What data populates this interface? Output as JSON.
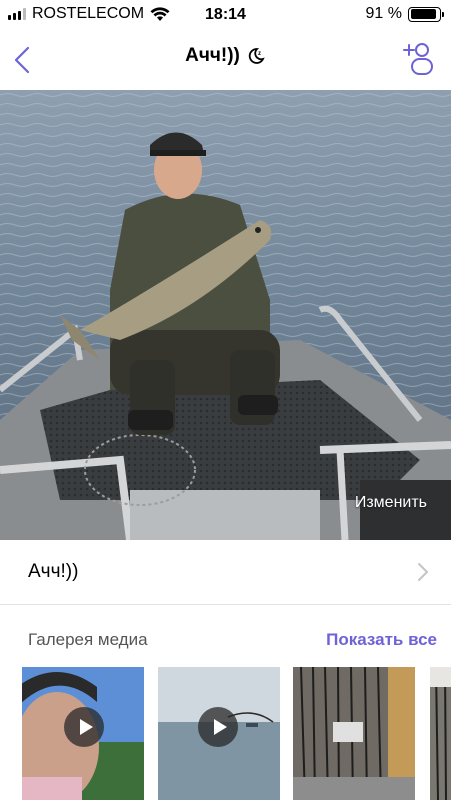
{
  "status": {
    "carrier": "ROSTELECOM",
    "time": "18:14",
    "battery": "91 %",
    "battery_level": 0.91
  },
  "nav": {
    "title": "Ачч!))",
    "back_icon": "chevron-left-icon",
    "mute_icon": "moon-icon",
    "add_member_icon": "add-user-icon",
    "accent_color": "#6d62d6"
  },
  "photo": {
    "edit_label": "Изменить"
  },
  "chat_name_row": {
    "label": "Ачч!))"
  },
  "gallery": {
    "title": "Галерея медиа",
    "show_all": "Показать все",
    "items": [
      {
        "type": "video"
      },
      {
        "type": "video"
      },
      {
        "type": "photo"
      },
      {
        "type": "photo"
      }
    ]
  }
}
